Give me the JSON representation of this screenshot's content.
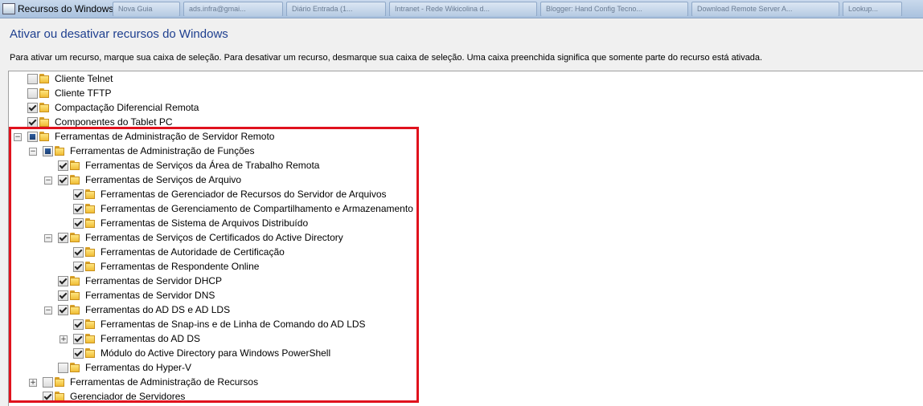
{
  "window": {
    "title": "Recursos do Windows",
    "background_tabs": [
      "Nova Guia",
      "ads.infra@gmai...",
      "Diário Entrada (1...",
      "Intranet - Rede Wikicolina d...",
      "Blogger: Hand Config Tecno...",
      "Download Remote Server A...",
      "Lookup..."
    ]
  },
  "header": {
    "heading": "Ativar ou desativar recursos do Windows",
    "instructions": "Para ativar um recurso, marque sua caixa de seleção. Para desativar um recurso, desmarque sua caixa de seleção. Uma caixa preenchida significa que somente parte do recurso está ativada."
  },
  "tree": {
    "items": [
      {
        "label": "Cliente Telnet",
        "level": 0,
        "state": "unchecked",
        "expander": "none"
      },
      {
        "label": "Cliente TFTP",
        "level": 0,
        "state": "unchecked",
        "expander": "none"
      },
      {
        "label": "Compactação Diferencial Remota",
        "level": 0,
        "state": "checked",
        "expander": "none"
      },
      {
        "label": "Componentes do Tablet PC",
        "level": 0,
        "state": "checked",
        "expander": "none"
      },
      {
        "label": "Ferramentas de Administração de Servidor Remoto",
        "level": 0,
        "state": "partial",
        "expander": "minus"
      },
      {
        "label": "Ferramentas de Administração de Funções",
        "level": 1,
        "state": "partial",
        "expander": "minus"
      },
      {
        "label": "Ferramentas de Serviços da Área de Trabalho Remota",
        "level": 2,
        "state": "checked",
        "expander": "none"
      },
      {
        "label": "Ferramentas de Serviços de Arquivo",
        "level": 2,
        "state": "checked",
        "expander": "minus"
      },
      {
        "label": "Ferramentas de Gerenciador de Recursos do Servidor de Arquivos",
        "level": 3,
        "state": "checked",
        "expander": "none"
      },
      {
        "label": "Ferramentas de Gerenciamento de Compartilhamento e Armazenamento",
        "level": 3,
        "state": "checked",
        "expander": "none"
      },
      {
        "label": "Ferramentas de Sistema de Arquivos Distribuído",
        "level": 3,
        "state": "checked",
        "expander": "none"
      },
      {
        "label": "Ferramentas de Serviços de Certificados do Active Directory",
        "level": 2,
        "state": "checked",
        "expander": "minus"
      },
      {
        "label": "Ferramentas de Autoridade de Certificação",
        "level": 3,
        "state": "checked",
        "expander": "none"
      },
      {
        "label": "Ferramentas de Respondente Online",
        "level": 3,
        "state": "checked",
        "expander": "none"
      },
      {
        "label": "Ferramentas de Servidor DHCP",
        "level": 2,
        "state": "checked",
        "expander": "none"
      },
      {
        "label": "Ferramentas de Servidor DNS",
        "level": 2,
        "state": "checked",
        "expander": "none"
      },
      {
        "label": "Ferramentas do AD DS e AD LDS",
        "level": 2,
        "state": "checked",
        "expander": "minus"
      },
      {
        "label": "Ferramentas de Snap-ins e de Linha de Comando do AD LDS",
        "level": 3,
        "state": "checked",
        "expander": "none"
      },
      {
        "label": "Ferramentas do AD DS",
        "level": 3,
        "state": "checked",
        "expander": "plus"
      },
      {
        "label": "Módulo do Active Directory para Windows PowerShell",
        "level": 3,
        "state": "checked",
        "expander": "none"
      },
      {
        "label": "Ferramentas do Hyper-V",
        "level": 2,
        "state": "unchecked",
        "expander": "none"
      },
      {
        "label": "Ferramentas de Administração de Recursos",
        "level": 1,
        "state": "unchecked",
        "expander": "plus"
      },
      {
        "label": "Gerenciador de Servidores",
        "level": 1,
        "state": "checked",
        "expander": "none"
      }
    ]
  },
  "colors": {
    "heading": "#1e3f8f",
    "highlight_border": "#e0121d",
    "folder": "#f0bd36"
  }
}
